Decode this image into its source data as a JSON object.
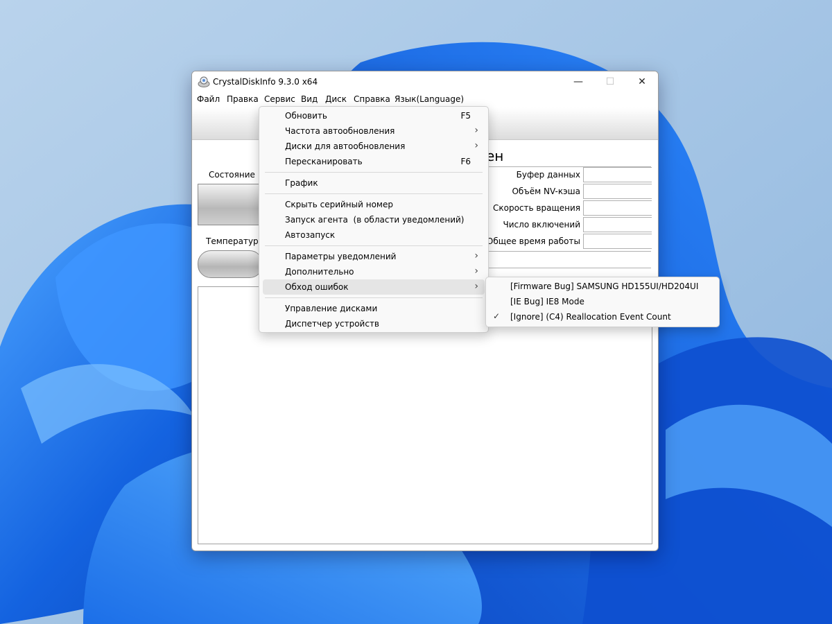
{
  "window": {
    "title": "CrystalDiskInfo 9.3.0 x64",
    "minimize_glyph": "—",
    "maximize_glyph": "☐",
    "close_glyph": "✕"
  },
  "menubar": [
    "Файл",
    "Правка",
    "Сервис",
    "Вид",
    "Диск",
    "Справка",
    "Язык(Language)"
  ],
  "main": {
    "title_fragment": "ен",
    "status_label": "Состояние",
    "temperature_label": "Температура",
    "info_labels": [
      "Буфер данных",
      "Объём NV-кэша",
      "Скорость вращения",
      "Число включений",
      "Общее время работы"
    ]
  },
  "service_menu": {
    "items": [
      {
        "label": "Обновить",
        "shortcut": "F5"
      },
      {
        "label": "Частота автообновления",
        "arrow": "›"
      },
      {
        "label": "Диски для автообновления",
        "arrow": "›"
      },
      {
        "label": "Пересканировать",
        "shortcut": "F6"
      },
      {
        "label": "График"
      },
      {
        "label": "Скрыть серийный номер"
      },
      {
        "label": "Запуск агента  (в области уведомлений)"
      },
      {
        "label": "Автозапуск"
      },
      {
        "label": "Параметры уведомлений",
        "arrow": "›"
      },
      {
        "label": "Дополнительно",
        "arrow": "›"
      },
      {
        "label": "Обход ошибок",
        "arrow": "›"
      },
      {
        "label": "Управление дисками"
      },
      {
        "label": "Диспетчер устройств"
      }
    ]
  },
  "workaround_submenu": {
    "items": [
      {
        "label": "[Firmware Bug] SAMSUNG HD155UI/HD204UI",
        "checked": false
      },
      {
        "label": "[IE Bug] IE8 Mode",
        "checked": false
      },
      {
        "label": "[Ignore] (C4) Reallocation Event Count",
        "checked": true,
        "check_glyph": "✓"
      }
    ]
  },
  "colors": {
    "wallpaper_light": "#9fc3e8",
    "wallpaper_blue": "#1565d8",
    "menu_highlight": "#e5e5e5"
  }
}
